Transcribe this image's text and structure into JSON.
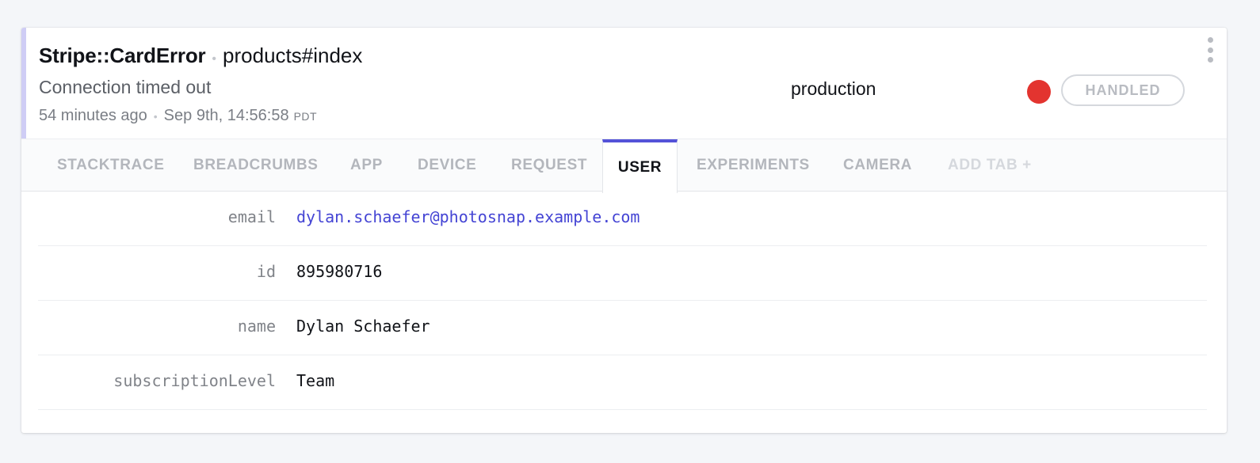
{
  "header": {
    "error_class": "Stripe::CardError",
    "context": "products#index",
    "message": "Connection timed out",
    "relative_time": "54 minutes ago",
    "absolute_time": "Sep 9th, 14:56:58",
    "timezone": "PDT",
    "environment": "production",
    "status_label": "HANDLED",
    "status_color": "#e3342f",
    "accent_color": "#cfcdf5"
  },
  "tabs": [
    {
      "label": "STACKTRACE",
      "active": false
    },
    {
      "label": "BREADCRUMBS",
      "active": false
    },
    {
      "label": "APP",
      "active": false
    },
    {
      "label": "DEVICE",
      "active": false
    },
    {
      "label": "REQUEST",
      "active": false
    },
    {
      "label": "USER",
      "active": true
    },
    {
      "label": "EXPERIMENTS",
      "active": false
    },
    {
      "label": "CAMERA",
      "active": false
    }
  ],
  "add_tab_label": "ADD TAB +",
  "active_tab_color": "#5452d8",
  "user": [
    {
      "key": "email",
      "value": "dylan.schaefer@photosnap.example.com",
      "is_link": true
    },
    {
      "key": "id",
      "value": "895980716",
      "is_link": false
    },
    {
      "key": "name",
      "value": "Dylan Schaefer",
      "is_link": false
    },
    {
      "key": "subscriptionLevel",
      "value": "Team",
      "is_link": false
    }
  ],
  "icons": {
    "more_menu": "vertical-dots-icon"
  }
}
